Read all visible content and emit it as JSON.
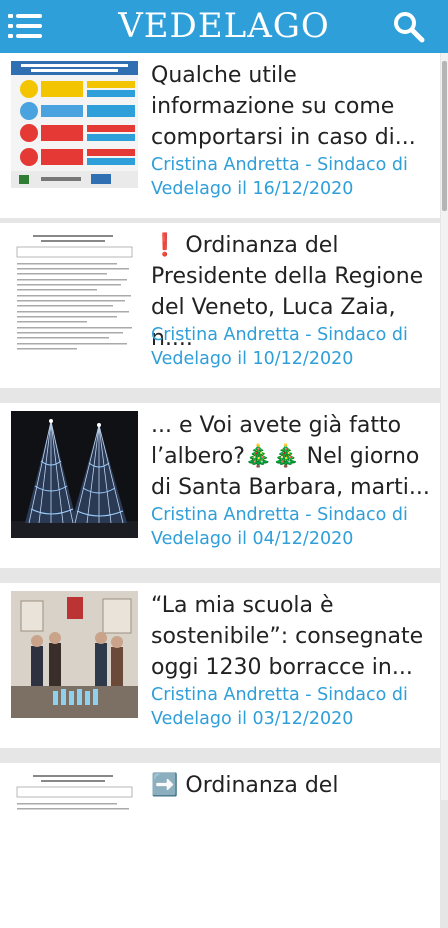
{
  "app": {
    "title": "VEDELAGO"
  },
  "icons": {
    "menu": "menu-icon",
    "search": "search-icon"
  },
  "colors": {
    "accent": "#2f9fd9",
    "title_text": "#222222"
  },
  "posts": [
    {
      "title": "Qualche utile informazione su come comportarsi in caso di...",
      "meta": "Cristina Andretta - Sindaco di Vedelago il 16/12/2020"
    },
    {
      "title": "❗ Ordinanza del Presidente della Regione del Veneto, Luca Zaia, n....",
      "meta": "Cristina Andretta - Sindaco di Vedelago il 10/12/2020"
    },
    {
      "title": "... e Voi avete già fatto l’albero?🎄🎄 Nel giorno di Santa Barbara, marti...",
      "meta": "Cristina Andretta - Sindaco di Vedelago il 04/12/2020"
    },
    {
      "title": "“La mia scuola è sostenibile”: consegnate oggi 1230 borracce in...",
      "meta": "Cristina Andretta - Sindaco di Vedelago il 03/12/2020"
    },
    {
      "title": "➡️ Ordinanza del",
      "meta": ""
    }
  ]
}
